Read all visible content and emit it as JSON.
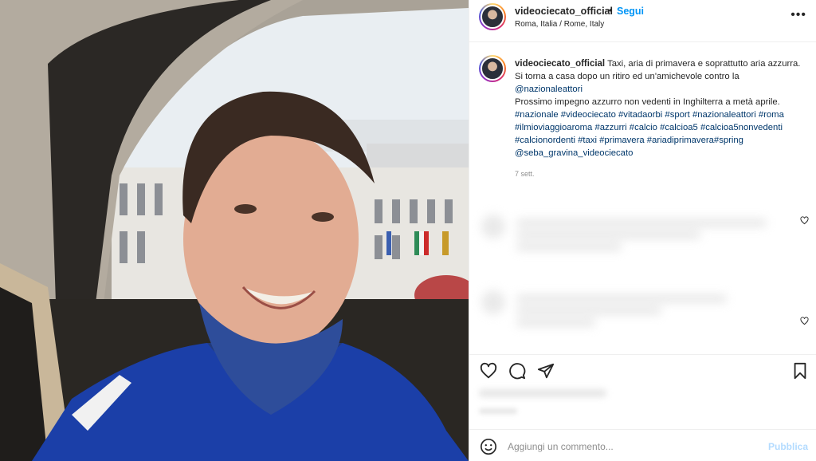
{
  "post": {
    "username": "videociecato_official",
    "follow_label": "Segui",
    "separator": "•",
    "location": "Roma, Italia / Rome, Italy",
    "more_label": "•••"
  },
  "caption": {
    "username": "videociecato_official",
    "line1": "Taxi, aria di primavera e soprattutto aria azzurra.",
    "line2": "Si torna a casa dopo un ritiro ed un'amichevole contro la",
    "mention1": "@nazionaleattori",
    "line3": "Prossimo impegno azzurro non vedenti in Inghilterra a metà aprile.",
    "hashtags": "#nazionale #videociecato #vitadaorbi #sport #nazionaleattori #roma #ilmioviaggioaroma #azzurri #calcio #calcioa5 #calcioa5nonvedenti #calcionordenti",
    "hashtags_full": "#nazionale #videociecato #vitadaorbi #sport #nazionaleattori #roma #ilmioviaggioaroma #azzurri #calcio #calcioa5 #calcioa5nonvedenti #calcionordenti #taxi #primavera #ariadiprimavera#spring",
    "mention2": "@seba_gravina_videociecato",
    "time": "7 sett."
  },
  "comment_bar": {
    "placeholder": "Aggiungi un commento...",
    "publish_label": "Pubblica"
  },
  "icons": {
    "like": "heart-icon",
    "comment": "comment-icon",
    "share": "paper-plane-icon",
    "save": "bookmark-icon",
    "emoji": "smiley-icon",
    "comment_like": "heart-icon"
  },
  "colors": {
    "accent": "#0095f6",
    "link": "#00376b",
    "muted": "#8e8e8e",
    "publish_disabled": "#b3dbff"
  }
}
